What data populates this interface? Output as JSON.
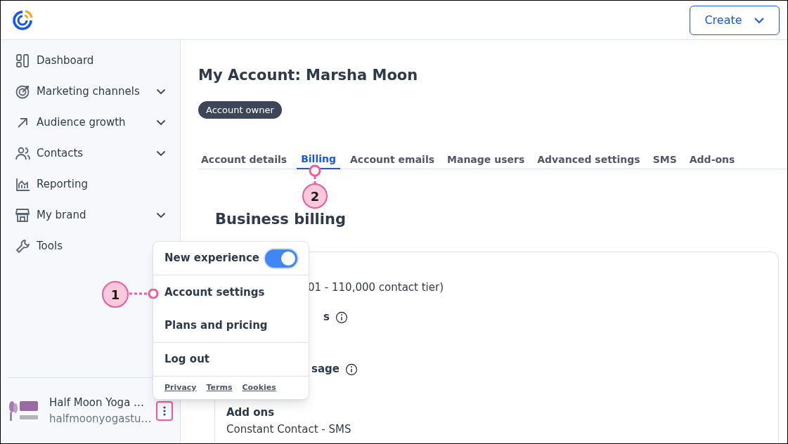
{
  "header": {
    "create_button": "Create"
  },
  "sidebar": {
    "items": [
      {
        "label": "Dashboard",
        "expandable": false
      },
      {
        "label": "Marketing channels",
        "expandable": true
      },
      {
        "label": "Audience growth",
        "expandable": true
      },
      {
        "label": "Contacts",
        "expandable": true
      },
      {
        "label": "Reporting",
        "expandable": false
      },
      {
        "label": "My brand",
        "expandable": true
      },
      {
        "label": "Tools"
      }
    ],
    "account": {
      "name": "Half Moon Yoga …",
      "email": "halfmoonyogastu…"
    }
  },
  "page": {
    "title": "My Account: Marsha Moon",
    "badge": "Account owner",
    "tabs": [
      {
        "label": "Account details",
        "selected": false
      },
      {
        "label": "Billing",
        "selected": true
      },
      {
        "label": "Account emails",
        "selected": false
      },
      {
        "label": "Manage users",
        "selected": false
      },
      {
        "label": "Advanced settings",
        "selected": false
      },
      {
        "label": "SMS",
        "selected": false
      },
      {
        "label": "Add-ons",
        "selected": false
      }
    ],
    "section_title": "Business billing",
    "card": {
      "lines": [
        {
          "kind": "text",
          "text": "01 - 110,000 contact tier)"
        },
        {
          "kind": "label_info",
          "text": "s"
        },
        {
          "kind": "label_info",
          "text": "sage"
        },
        {
          "kind": "heading",
          "text": "Add ons"
        },
        {
          "kind": "text",
          "text": "Constant Contact - SMS"
        }
      ]
    }
  },
  "account_menu": {
    "toggle": {
      "label": "New experience",
      "on": true
    },
    "items": [
      "Account settings",
      "Plans and pricing",
      "Log out"
    ],
    "links": [
      "Privacy",
      "Terms",
      "Cookies"
    ]
  },
  "callouts": [
    {
      "number": "1"
    },
    {
      "number": "2"
    }
  ]
}
